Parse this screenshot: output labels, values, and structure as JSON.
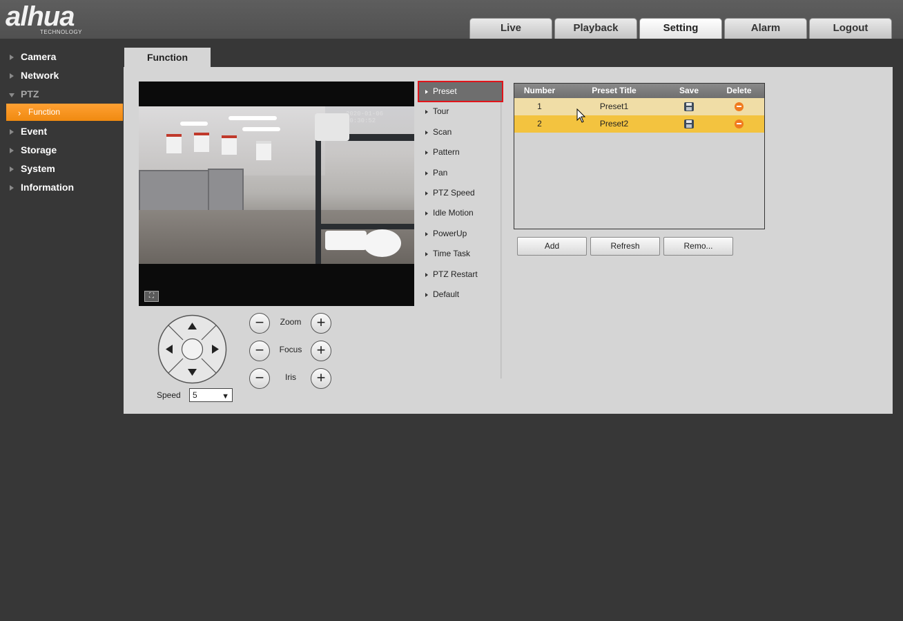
{
  "brand": {
    "logo": "alhua",
    "subtitle": "TECHNOLOGY"
  },
  "topnav": [
    "Live",
    "Playback",
    "Setting",
    "Alarm",
    "Logout"
  ],
  "topnav_active": "Setting",
  "sidebar": {
    "items": [
      {
        "label": "Camera"
      },
      {
        "label": "Network"
      },
      {
        "label": "PTZ"
      },
      {
        "label": "Event"
      },
      {
        "label": "Storage"
      },
      {
        "label": "System"
      },
      {
        "label": "Information"
      }
    ],
    "subitem": {
      "label": "Function"
    }
  },
  "content_tab": "Function",
  "video": {
    "timestamp": "2020-01-06 10:30:52"
  },
  "ptz": {
    "zoom_label": "Zoom",
    "focus_label": "Focus",
    "iris_label": "Iris",
    "speed_label": "Speed",
    "speed_value": "5",
    "minus": "−",
    "plus": "+"
  },
  "function_menu": [
    "Preset",
    "Tour",
    "Scan",
    "Pattern",
    "Pan",
    "PTZ Speed",
    "Idle Motion",
    "PowerUp",
    "Time Task",
    "PTZ Restart",
    "Default"
  ],
  "function_menu_active": "Preset",
  "preset_table": {
    "headers": [
      "Number",
      "Preset Title",
      "Save",
      "Delete"
    ],
    "rows": [
      {
        "number": "1",
        "title": "Preset1"
      },
      {
        "number": "2",
        "title": "Preset2"
      }
    ]
  },
  "actions": {
    "add": "Add",
    "refresh": "Refresh",
    "remove": "Remo..."
  },
  "colors": {
    "accent_orange": "#f08a10",
    "row_selected": "#f3c33f",
    "row_normal": "#f0dda6",
    "highlight_border": "#e0141a"
  }
}
